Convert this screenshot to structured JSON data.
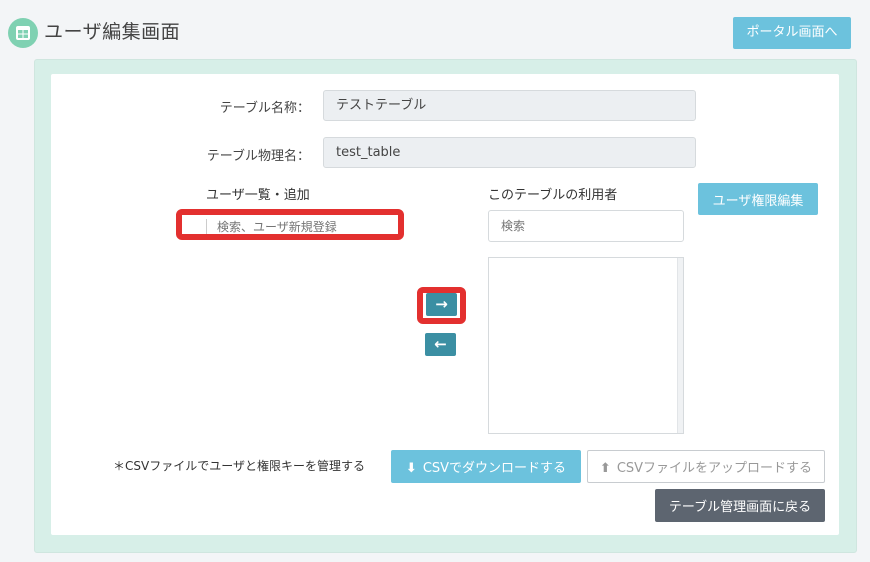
{
  "header": {
    "title": "ユーザ編集画面",
    "portal_button": "ポータル画面へ",
    "icon": "table-grid-icon"
  },
  "form": {
    "table_name_label": "テーブル名称：",
    "table_name_value": "テストテーブル",
    "physical_name_label": "テーブル物理名：",
    "physical_name_value": "test_table"
  },
  "user_list": {
    "label": "ユーザ一覧・追加",
    "search_placeholder": "検索、ユーザ新規登録"
  },
  "table_users": {
    "label": "このテーブルの利用者",
    "search_placeholder": "検索",
    "permission_button": "ユーザ権限編集"
  },
  "transfer": {
    "add_icon": "arrow-right-icon",
    "remove_icon": "arrow-left-icon",
    "add_glyph": "→",
    "remove_glyph": "←"
  },
  "csv": {
    "note": "＊CSVファイルでユーザと権限キーを管理する",
    "download_label": "CSVでダウンロードする",
    "upload_label": "CSVファイルをアップロードする"
  },
  "back_button": "テーブル管理画面に戻る",
  "colors": {
    "accent": "#6cc2dd",
    "icon_bg": "#7fd1b2",
    "highlight": "#e3302f",
    "arrow": "#3b8fa3",
    "dark_button": "#5d6570"
  }
}
